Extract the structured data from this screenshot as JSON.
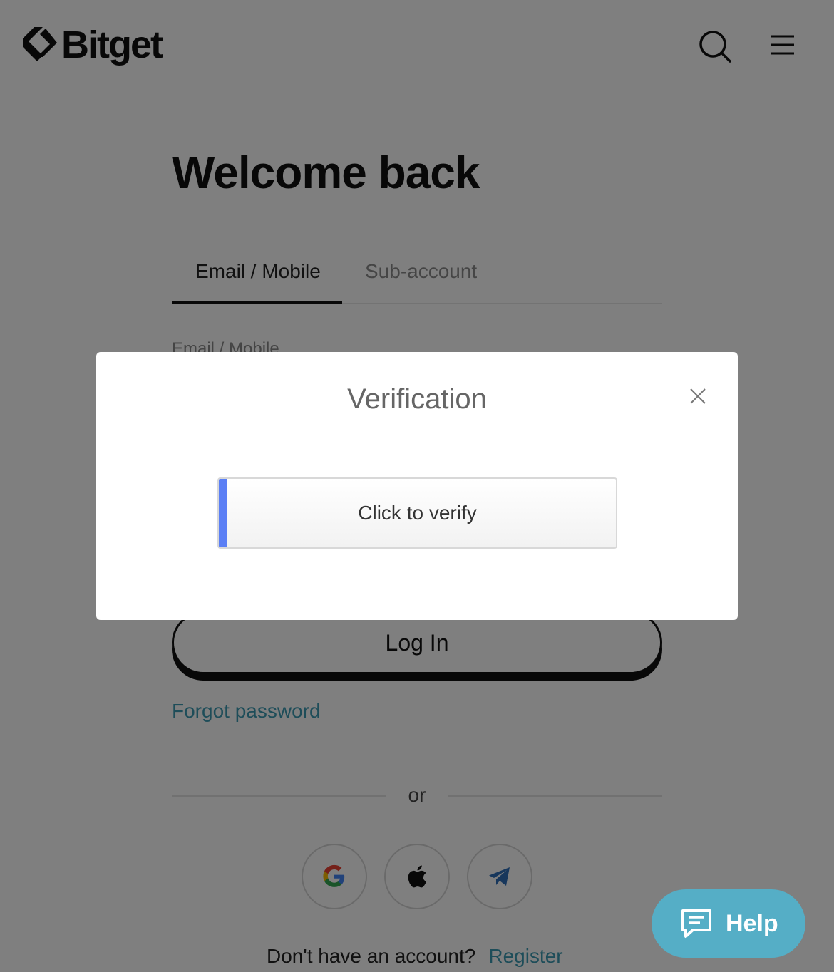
{
  "header": {
    "brand": "Bitget",
    "search_icon": "search-icon",
    "menu_icon": "menu-icon"
  },
  "login": {
    "title": "Welcome back",
    "tabs": [
      {
        "label": "Email / Mobile",
        "active": true
      },
      {
        "label": "Sub-account",
        "active": false
      }
    ],
    "field_label": "Email / Mobile",
    "login_button": "Log In",
    "forgot_password": "Forgot password",
    "divider": "or",
    "social": [
      {
        "icon": "google-icon"
      },
      {
        "icon": "apple-icon"
      },
      {
        "icon": "telegram-icon"
      }
    ],
    "no_account": "Don't have an account?",
    "register": "Register"
  },
  "modal": {
    "title": "Verification",
    "verify_button": "Click to verify",
    "close_icon": "close-icon"
  },
  "help": {
    "label": "Help",
    "icon": "chat-icon"
  },
  "colors": {
    "link": "#3d9bb3",
    "help_bg": "#55aec6",
    "verify_accent": "#5b7ff5",
    "overlay": "rgba(0,0,0,0.5)"
  }
}
